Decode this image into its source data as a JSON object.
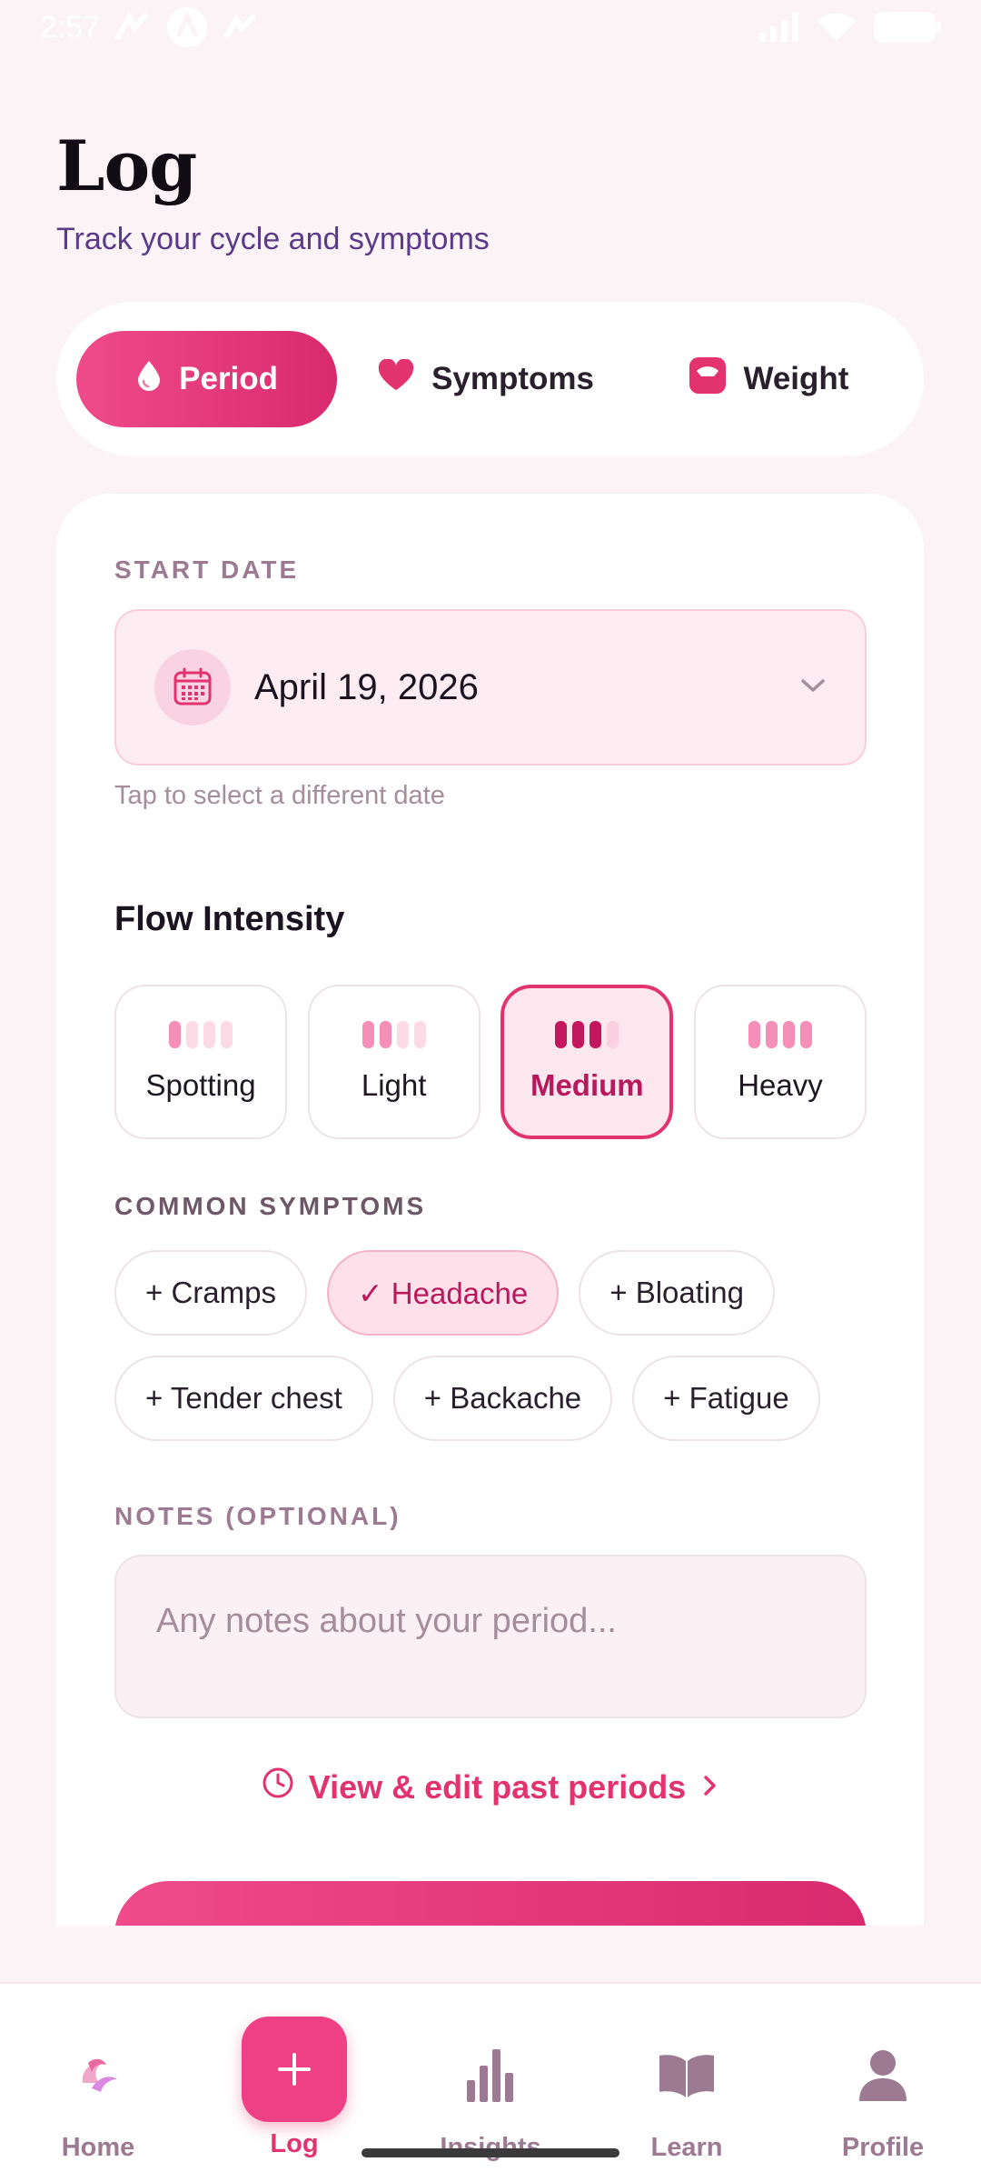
{
  "status_bar": {
    "time": "2:57"
  },
  "header": {
    "title": "Log",
    "subtitle": "Track your cycle and symptoms"
  },
  "tabs": [
    {
      "label": "Period",
      "icon": "drop-icon",
      "active": true
    },
    {
      "label": "Symptoms",
      "icon": "heart-icon",
      "active": false
    },
    {
      "label": "Weight",
      "icon": "scale-icon",
      "active": false
    }
  ],
  "start_date": {
    "label": "START DATE",
    "value": "April 19, 2026",
    "hint": "Tap to select a different date"
  },
  "flow": {
    "title": "Flow Intensity",
    "options": [
      {
        "label": "Spotting",
        "level": 1
      },
      {
        "label": "Light",
        "level": 2
      },
      {
        "label": "Medium",
        "level": 3,
        "selected": true
      },
      {
        "label": "Heavy",
        "level": 4
      }
    ]
  },
  "symptoms": {
    "label": "COMMON SYMPTOMS",
    "items": [
      {
        "label": "+ Cramps",
        "selected": false
      },
      {
        "label": "✓ Headache",
        "selected": true
      },
      {
        "label": "+ Bloating",
        "selected": false
      },
      {
        "label": "+ Tender chest",
        "selected": false
      },
      {
        "label": "+ Backache",
        "selected": false
      },
      {
        "label": "+ Fatigue",
        "selected": false
      }
    ]
  },
  "notes": {
    "label": "NOTES (OPTIONAL)",
    "placeholder": "Any notes about your period..."
  },
  "past_link": "View & edit past periods",
  "nav": [
    {
      "label": "Home",
      "icon": "flower-logo-icon"
    },
    {
      "label": "Log",
      "icon": "plus-icon",
      "active": true
    },
    {
      "label": "Insights",
      "icon": "bar-chart-icon"
    },
    {
      "label": "Learn",
      "icon": "book-icon"
    },
    {
      "label": "Profile",
      "icon": "person-icon"
    }
  ],
  "colors": {
    "accent": "#E2336F",
    "background": "#FBF3F5",
    "subtitle": "#5B3A8A"
  }
}
